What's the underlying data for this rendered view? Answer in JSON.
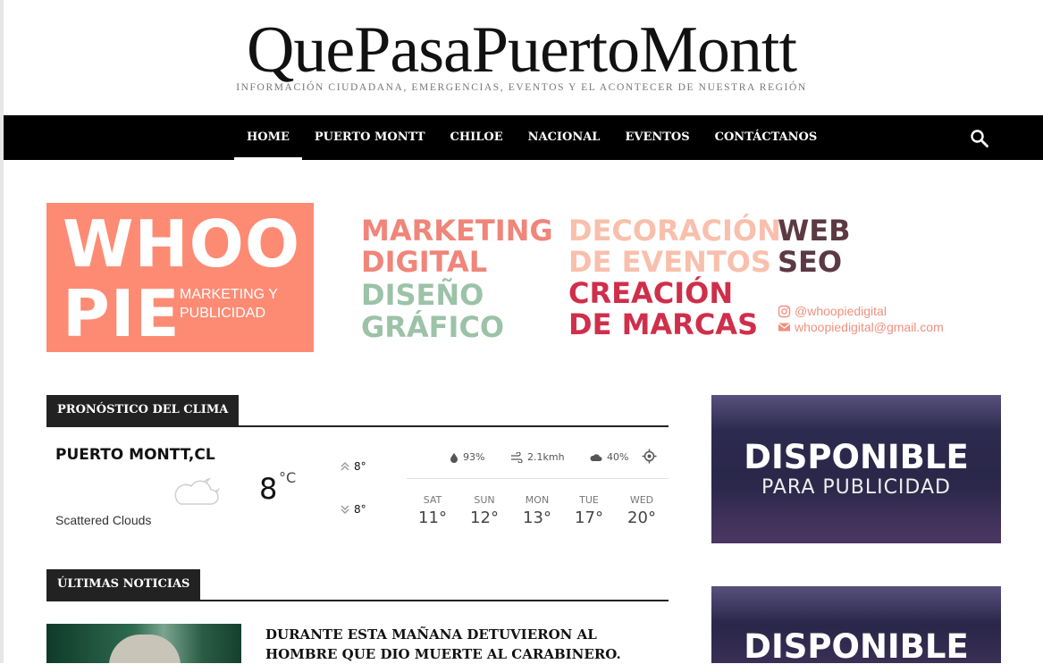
{
  "site": {
    "title": "QuePasaPuertoMontt",
    "tagline": "INFORMACIÓN CIUDADANA, EMERGENCIAS, EVENTOS Y EL ACONTECER DE NUESTRA REGIÓN"
  },
  "nav": {
    "items": [
      {
        "label": "HOME",
        "active": true
      },
      {
        "label": "PUERTO MONTT"
      },
      {
        "label": "CHILOE"
      },
      {
        "label": "NACIONAL"
      },
      {
        "label": "EVENTOS"
      },
      {
        "label": "CONTÁCTANOS"
      }
    ],
    "search_icon": "search-icon"
  },
  "banner": {
    "brand_line1": "WHOO",
    "brand_line2": "PIE",
    "brand_sub_line1": "MARKETING Y",
    "brand_sub_line2": "PUBLICIDAD",
    "marketing_line1": "MARKETING",
    "marketing_line2": "DIGITAL",
    "diseno_line1": "DISEÑO",
    "diseno_line2": "GRÁFICO",
    "decoracion_line1": "DECORACIÓN",
    "decoracion_line2": "DE EVENTOS",
    "creacion_line1": "CREACIÓN",
    "creacion_line2": "DE MARCAS",
    "web": "WEB",
    "seo": "SEO",
    "instagram": "@whoopiedigital",
    "email": "whoopiedigital@gmail.com",
    "colors": {
      "brand_bg": "#fd8b74",
      "marketing": "#f0857a",
      "diseno": "#9cc2a8",
      "decoracion": "#f8c0ac",
      "creacion": "#cf2f4b",
      "web_seo": "#5b3a44"
    }
  },
  "weather": {
    "section_title": "PRONÓSTICO DEL CLIMA",
    "city": "PUERTO MONTT,CL",
    "description": "Scattered Clouds",
    "temp": "8",
    "unit": "°C",
    "high": "8°",
    "low": "8°",
    "humidity": "93%",
    "wind": "2.1kmh",
    "clouds": "40%",
    "forecast": [
      {
        "day": "SAT",
        "temp": "11°"
      },
      {
        "day": "SUN",
        "temp": "12°"
      },
      {
        "day": "MON",
        "temp": "13°"
      },
      {
        "day": "TUE",
        "temp": "17°"
      },
      {
        "day": "WED",
        "temp": "20°"
      }
    ]
  },
  "sidebar_ads": [
    {
      "title": "DISPONIBLE",
      "subtitle": "PARA PUBLICIDAD"
    },
    {
      "title": "DISPONIBLE"
    }
  ],
  "news": {
    "section_title": "ÚLTIMAS NOTICIAS",
    "items": [
      {
        "title": "DURANTE ESTA MAÑANA DETUVIERON AL HOMBRE QUE DIO MUERTE AL CARABINERO."
      }
    ]
  }
}
